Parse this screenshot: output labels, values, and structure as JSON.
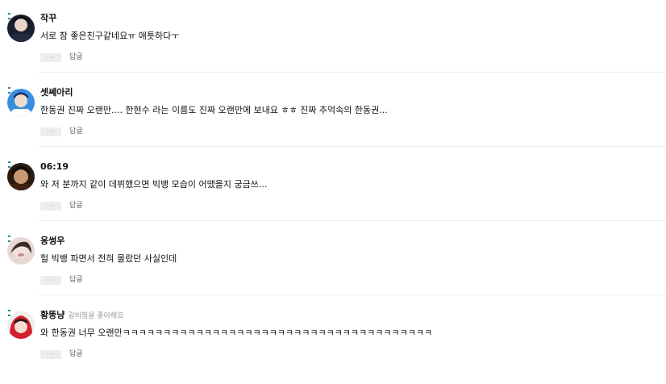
{
  "comments": [
    {
      "nickname": "작꾸",
      "note": "",
      "text": "서로 참 좋은친구같네요ㅠ 애틋하다ㅜ",
      "more_label": "···",
      "reply_label": "답글",
      "avatar_icon": "profile-avatar"
    },
    {
      "nickname": "셋쎄아리",
      "note": "",
      "text": "한동권 진짜 오랜만.... 한현수 라는 이름도 진짜 오랜만에 보내요 ㅎㅎ 진짜 추억속의 한동권...",
      "more_label": "···",
      "reply_label": "답글",
      "avatar_icon": "profile-avatar"
    },
    {
      "nickname": "06:19",
      "note": "",
      "text": "와 저 분까지 같이 데뷔했으면 빅뱅 모습이 어땠을지 궁금쓰...",
      "more_label": "···",
      "reply_label": "답글",
      "avatar_icon": "profile-avatar"
    },
    {
      "nickname": "옹썽우",
      "note": "",
      "text": "헐 빅뱅 파면서 전혀 몰랐던 사실인데",
      "more_label": "···",
      "reply_label": "답글",
      "avatar_icon": "profile-avatar"
    },
    {
      "nickname": "황뚱냥",
      "note": "갈비찜을 좋아해요",
      "text": "와 한동권 너무 오랜만ㅋㅋㅋㅋㅋㅋㅋㅋㅋㅋㅋㅋㅋㅋㅋㅋㅋㅋㅋㅋㅋㅋㅋㅋㅋㅋㅋㅋㅋㅋㅋㅋㅋㅋㅋㅋㅋㅋ",
      "more_label": "···",
      "reply_label": "답글",
      "avatar_icon": "profile-avatar"
    }
  ],
  "colors": {
    "avatar_1": "#1a1a2e",
    "avatar_2": "#2f7fd6",
    "avatar_3": "#2a1a10",
    "avatar_4": "#d9c7c2",
    "avatar_5": "#d0202a"
  }
}
